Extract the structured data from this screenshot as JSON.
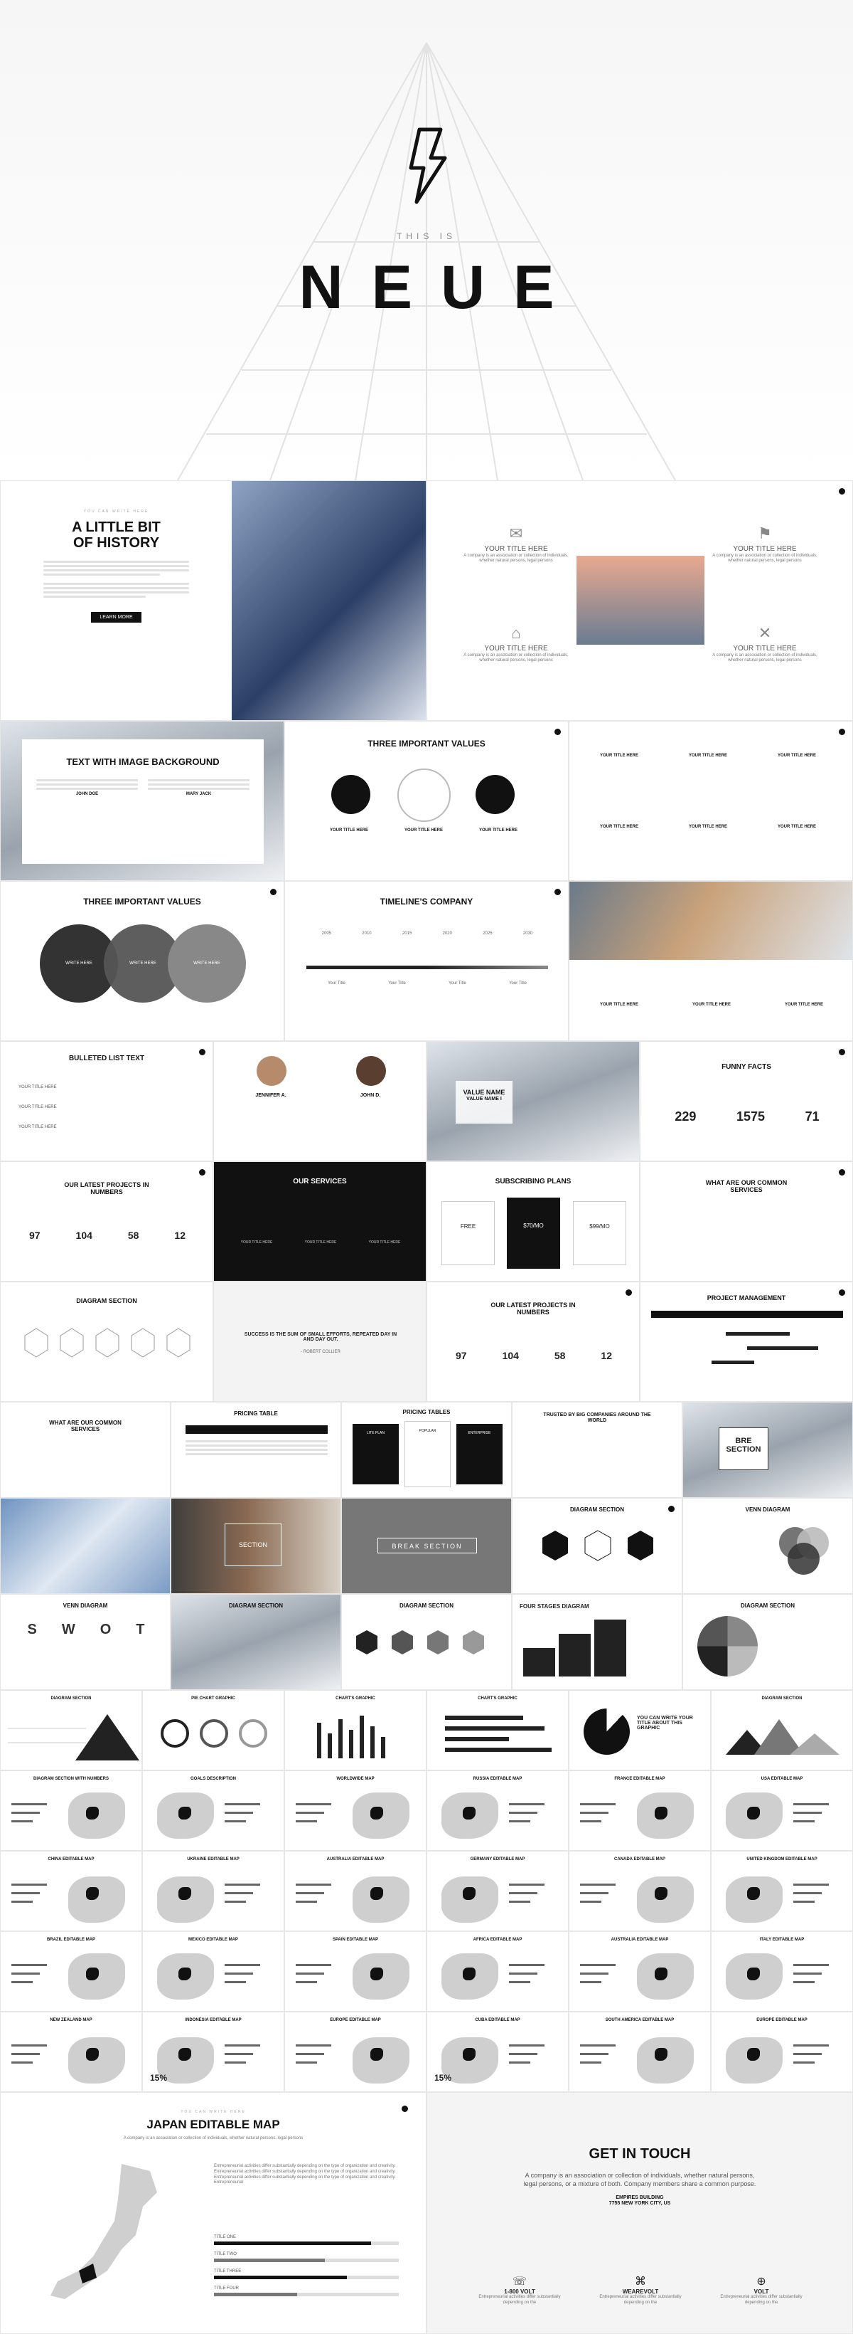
{
  "hero": {
    "kicker": "THIS IS",
    "title": "NEUE"
  },
  "history": {
    "kicker": "YOU CAN WRITE HERE",
    "title_line1": "A LITTLE BIT",
    "title_line2": "OF HISTORY",
    "button": "LEARN MORE"
  },
  "titles_slide": {
    "t1": "YOUR TITLE HERE",
    "t2": "YOUR TITLE HERE",
    "t3": "YOUR TITLE HERE",
    "t4": "YOUR TITLE HERE",
    "body": "A company is an association or collection of individuals, whether natural persons, legal persons"
  },
  "row2": {
    "text_bg_title": "TEXT WITH IMAGE BACKGROUND",
    "text_bg_name1": "JOHN DOE",
    "text_bg_name2": "MARY JACK",
    "three_values": "THREE IMPORTANT VALUES",
    "value_labels": [
      "YOUR TITLE HERE",
      "YOUR TITLE HERE",
      "YOUR TITLE HERE"
    ],
    "grid_labels": [
      "YOUR TITLE HERE",
      "YOUR TITLE HERE",
      "YOUR TITLE HERE",
      "YOUR TITLE HERE",
      "YOUR TITLE HERE",
      "YOUR TITLE HERE"
    ]
  },
  "row3": {
    "three_values": "THREE IMPORTANT VALUES",
    "circle_labels": [
      "WRITE HERE",
      "WRITE HERE",
      "WRITE HERE"
    ],
    "timeline_title": "TIMELINE'S COMPANY",
    "timeline_years": [
      "2005",
      "2010",
      "2015",
      "2020",
      "2025",
      "2030"
    ],
    "timeline_item": "Your Title",
    "photo_labels": [
      "YOUR TITLE HERE",
      "YOUR TITLE HERE",
      "YOUR TITLE HERE"
    ]
  },
  "row4": {
    "bulleted": "BULLETED LIST TEXT",
    "bullets": [
      "YOUR TITLE HERE",
      "YOUR TITLE HERE",
      "YOUR TITLE HERE"
    ],
    "person1": "JENNIFER A.",
    "person2": "JOHN D.",
    "value_name": "VALUE NAME",
    "value_1": "VALUE NAME I",
    "funny_facts": "FUNNY FACTS",
    "facts": [
      "229",
      "1575",
      "71"
    ]
  },
  "row5": {
    "latest_projects": "OUR LATEST PROJECTS IN NUMBERS",
    "numbers": [
      "97",
      "104",
      "58",
      "12"
    ],
    "services": "OUR SERVICES",
    "service_labels": [
      "YOUR TITLE HERE",
      "YOUR TITLE HERE",
      "YOUR TITLE HERE"
    ],
    "plans": "SUBSCRIBING PLANS",
    "plan_prices": [
      "FREE",
      "$70/MO",
      "$99/MO"
    ],
    "common_services": "WHAT ARE OUR COMMON SERVICES"
  },
  "row6": {
    "diagram": "DIAGRAM SECTION",
    "quote": "SUCCESS IS THE SUM OF SMALL EFFORTS, REPEATED DAY IN AND DAY OUT.",
    "quote_author": "- ROBERT COLLIER",
    "latest_projects": "OUR LATEST PROJECTS IN NUMBERS",
    "numbers": [
      "97",
      "104",
      "58",
      "12"
    ],
    "project_mgmt": "PROJECT MANAGEMENT"
  },
  "row7": {
    "common": "WHAT ARE OUR COMMON SERVICES",
    "pricing1": "PRICING TABLE",
    "pricing2": "PRICING TABLES",
    "pricing_cols": [
      "LITE PLAN",
      "POPULAR",
      "ENTERPRISE"
    ],
    "trusted": "TRUSTED BY BIG COMPANIES AROUND THE WORLD",
    "break": "BRE SECTION"
  },
  "row8": {
    "section": "SECTION",
    "break": "BREAK SECTION",
    "diagram": "DIAGRAM SECTION",
    "venn": "VENN DIAGRAM"
  },
  "row9": {
    "venn": "VENN DIAGRAM",
    "swot": [
      "S",
      "W",
      "O",
      "T"
    ],
    "diagram1": "DIAGRAM SECTION",
    "diagram2": "DIAGRAM SECTION",
    "four_stages": "FOUR STAGES DIAGRAM",
    "diagram3": "DIAGRAM SECTION"
  },
  "row10": {
    "titles": [
      "DIAGRAM SECTION",
      "PIE CHART GRAPHIC",
      "CHART'S GRAPHIC",
      "CHART'S GRAPHIC",
      "",
      "DIAGRAM SECTION"
    ],
    "pie_text": "YOU CAN WRITE YOUR TITLE ABOUT THIS GRAPHIC"
  },
  "maps": [
    [
      "DIAGRAM SECTION WITH NUMBERS",
      "GOALS DESCRIPTION",
      "WORLDWIDE MAP",
      "RUSSIA EDITABLE MAP",
      "FRANCE EDITABLE MAP",
      "USA EDITABLE MAP"
    ],
    [
      "CHINA EDITABLE MAP",
      "UKRAINE EDITABLE MAP",
      "AUSTRALIA EDITABLE MAP",
      "GERMANY EDITABLE MAP",
      "CANADA EDITABLE MAP",
      "UNITED KINGDOM EDITABLE MAP"
    ],
    [
      "BRAZIL EDITABLE MAP",
      "MEXICO EDITABLE MAP",
      "SPAIN EDITABLE MAP",
      "AFRICA EDITABLE MAP",
      "AUSTRALIA EDITABLE MAP",
      "ITALY EDITABLE MAP"
    ],
    [
      "NEW ZEALAND MAP",
      "INDONESIA EDITABLE MAP",
      "EUROPE EDITABLE MAP",
      "CUBA EDITABLE MAP",
      "SOUTH AMERICA EDITABLE MAP",
      "EUROPE EDITABLE MAP"
    ]
  ],
  "map_percent": [
    "15%",
    "15%"
  ],
  "japan": {
    "kicker": "YOU CAN WRITE HERE",
    "title": "JAPAN EDITABLE MAP",
    "subtitle": "A company is an association or collection of individuals, whether natural persons, legal persons",
    "body": "Entrepreneurial activities differ substantially depending on the type of organization and creativity. Entrepreneurial activities differ substantially depending on the type of organization and creativity. Entrepreneurial activities differ substantially depending on the type of organization and creativity. Entrepreneurial",
    "bars": [
      "TITLE ONE",
      "TITLE TWO",
      "TITLE THREE",
      "TITLE FOUR"
    ],
    "bar_values": [
      0.85,
      0.6,
      0.72,
      0.45
    ]
  },
  "contact": {
    "title": "GET IN TOUCH",
    "body": "A company is an association or collection of individuals, whether natural persons, legal persons, or a mixture of both. Company members share a common purpose.",
    "address1": "EMPIRES BUILDING",
    "address2": "7755 NEW YORK CITY, US",
    "items": [
      {
        "title": "1-800 VOLT",
        "text": "Entrepreneurial activities differ substantially depending on the"
      },
      {
        "title": "WEAREVOLT",
        "text": "Entrepreneurial activities differ substantially depending on the"
      },
      {
        "title": "VOLT",
        "text": "Entrepreneurial activities differ substantially depending on the"
      }
    ]
  }
}
